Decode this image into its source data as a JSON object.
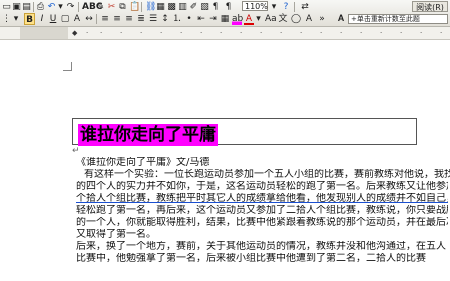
{
  "toolbar": {
    "zoom": "110%",
    "read_mode": "阅读(R)",
    "style_box": "+单击重新计数至此题",
    "font_color_label": "A",
    "highlight_label": "ab"
  },
  "document": {
    "title": "谁拉你走向了平庸",
    "byline": "《谁拉你走向了平庸》文/马德",
    "lines": [
      "有这样一个实验：一位长跑运动员参加一个五人小组的比赛，赛前教练对他说，我找",
      "的四个人的实力并不如你，于是，这名运动员轻松的跑了第一名。后来教练又让他参加",
      "个拾人个组比赛，教练把平时其它人的成绩拿给他看，他发现别人的成绩并不如自己，",
      "轻松跑了第一名，再后来，这个运动员又参加了二拾人个组比赛，教练说，你只要战胜",
      "的一个人，你就能取得胜利，结果，比赛中他紧跟着教练说的那个运动员，并在最后冲",
      "又取得了第一名。",
      "后来，换了一个地方，赛前，关于其他运动员的情况，教练并没和他沟通过，在五人",
      "比赛中，他勉强拿了第一名，后来被小组比赛中他遭到了第二名，二拾人的比赛"
    ]
  }
}
